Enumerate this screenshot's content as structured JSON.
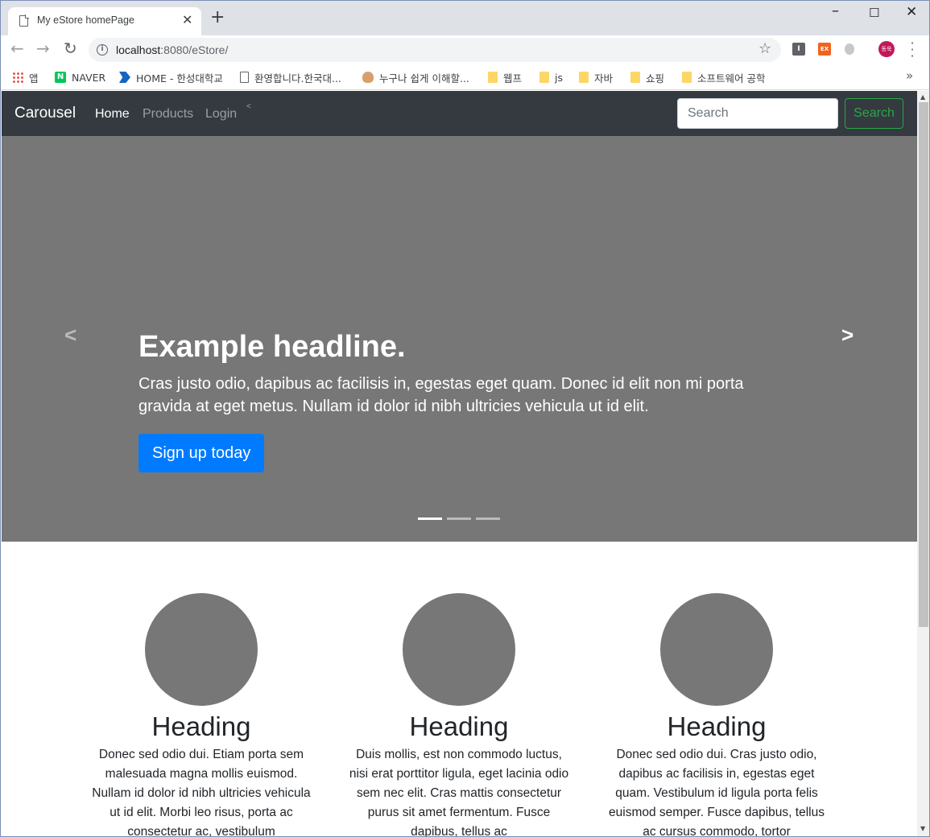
{
  "browser": {
    "tab_title": "My eStore homePage",
    "tab_close": "✕",
    "new_tab": "+",
    "url_host": "localhost",
    "url_rest": ":8080/eStore/",
    "profile_initials": "동욱",
    "bookmarks": [
      {
        "label": "앱",
        "icon": "apps-grid-icon"
      },
      {
        "label": "NAVER",
        "icon": "naver-icon"
      },
      {
        "label": "HOME - 한성대학교",
        "icon": "hansung-icon"
      },
      {
        "label": "환영합니다.한국대...",
        "icon": "page-icon"
      },
      {
        "label": "누구나 쉽게 이해할...",
        "icon": "person-icon"
      },
      {
        "label": "웹프",
        "icon": "folder-icon"
      },
      {
        "label": "js",
        "icon": "folder-icon"
      },
      {
        "label": "자바",
        "icon": "folder-icon"
      },
      {
        "label": "쇼핑",
        "icon": "folder-icon"
      },
      {
        "label": "소프트웨어 공학",
        "icon": "folder-icon"
      }
    ]
  },
  "navbar": {
    "brand": "Carousel",
    "links": [
      "Home",
      "Products",
      "Login"
    ],
    "caret": "<",
    "search_placeholder": "Search",
    "search_button": "Search"
  },
  "carousel": {
    "headline": "Example headline.",
    "text": "Cras justo odio, dapibus ac facilisis in, egestas eget quam. Donec id elit non mi porta gravida at eget metus. Nullam id dolor id nibh ultricies vehicula ut id elit.",
    "cta": "Sign up today",
    "slide_count": 3,
    "active_slide": 1
  },
  "columns": [
    {
      "heading": "Heading",
      "text": "Donec sed odio dui. Etiam porta sem malesuada magna mollis euismod. Nullam id dolor id nibh ultricies vehicula ut id elit. Morbi leo risus, porta ac consectetur ac, vestibulum"
    },
    {
      "heading": "Heading",
      "text": "Duis mollis, est non commodo luctus, nisi erat porttitor ligula, eget lacinia odio sem nec elit. Cras mattis consectetur purus sit amet fermentum. Fusce dapibus, tellus ac"
    },
    {
      "heading": "Heading",
      "text": "Donec sed odio dui. Cras justo odio, dapibus ac facilisis in, egestas eget quam. Vestibulum id ligula porta felis euismod semper. Fusce dapibus, tellus ac cursus commodo, tortor"
    }
  ],
  "colors": {
    "navbar_bg": "#343a40",
    "carousel_bg": "#777777",
    "primary": "#007bff",
    "success": "#28a745"
  }
}
